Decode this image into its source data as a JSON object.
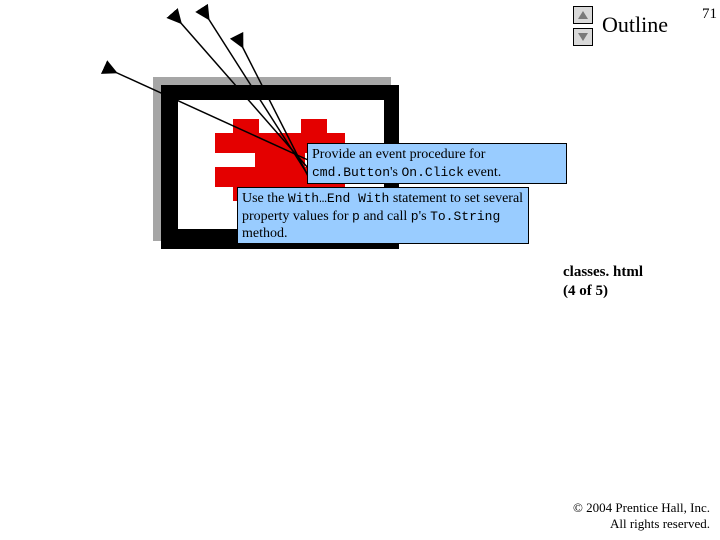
{
  "header": {
    "title": "Outline",
    "page_number": "71"
  },
  "callouts": {
    "c1_l1": "Provide an event procedure for",
    "c1_code1": "cmd.Button",
    "c1_mid1": "'s ",
    "c1_code2": "On.Click",
    "c1_tail1": " event.",
    "c2_pre": "Use the ",
    "c2_code1": "With…End With",
    "c2_mid": " statement to set several property values for ",
    "c2_code2": "p",
    "c2_mid2": " and call ",
    "c2_code3": "p",
    "c2_mid3": "'s ",
    "c2_code4": "To.String",
    "c2_tail": " method."
  },
  "file": {
    "name": "classes. html",
    "pages": "(4 of 5)"
  },
  "footer": {
    "line1": "© 2004 Prentice Hall, Inc.",
    "line2": "All rights reserved."
  }
}
